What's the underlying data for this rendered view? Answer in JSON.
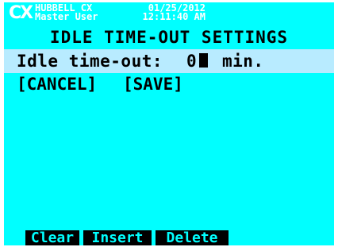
{
  "header": {
    "logo": "CX",
    "brand": "HUBBELL CX",
    "user": "Master User",
    "date": "01/25/2012",
    "time": "12:11:40 AM"
  },
  "title": "IDLE TIME-OUT SETTINGS",
  "field": {
    "label": "Idle time-out:",
    "value": "0",
    "unit": "min."
  },
  "actions": {
    "cancel": "[CANCEL]",
    "save": "[SAVE]"
  },
  "softkeys": {
    "clear": "Clear",
    "insert": "Insert",
    "delete": "Delete"
  },
  "colors": {
    "screen_background": "#00ffff",
    "selected_row": "#b8ebff",
    "softkey_background": "#000000",
    "softkey_text": "#00ffff"
  }
}
